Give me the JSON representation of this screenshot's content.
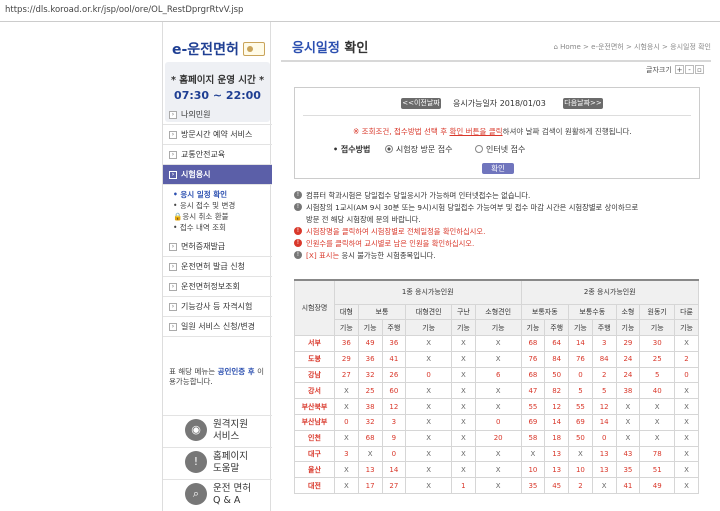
{
  "url": "https://dls.koroad.or.kr/jsp/ool/ore/OL_RestDprgrRtvV.jsp",
  "logo": "e-운전면허",
  "hours": {
    "title": "* 홈페이지 운영 시간 *",
    "time": "07:30 ~ 22:00"
  },
  "menu": {
    "top": [
      "나의민원",
      "방문시간 예약 서비스",
      "교통안전교육",
      "시험응시"
    ],
    "sub": [
      "응시 일정 확인",
      "응시 접수 및 변경",
      "응시 취소 환불",
      "접수 내역 조회"
    ],
    "bottom": [
      "면허증재발급",
      "운전면허 발급 신청",
      "운전면허정보조회",
      "기능강사 등 자격시험",
      "일원 서비스 신청/변경"
    ]
  },
  "note": {
    "pre": "표 해당 메뉴는 ",
    "link": "공인인증 후",
    "post": " 이용가능합니다."
  },
  "services": [
    {
      "icon": "wifi-icon",
      "glyph": "◉",
      "line1": "원격지원",
      "line2": "서비스"
    },
    {
      "icon": "alert-icon",
      "glyph": "!",
      "line1": "홈페이지",
      "line2": "도움말"
    },
    {
      "icon": "search-icon",
      "glyph": "⌕",
      "line1": "운전 면허",
      "line2": "Q & A"
    }
  ],
  "main": {
    "title_a": "응시일정",
    "title_b": " 확인",
    "breadcrumb": "⌂ Home > e-운전면허 > 시험응시 > 응시일정 확인",
    "fontsize_label": "글자크기",
    "prev_date": "<<이전날짜",
    "date_label": "응시가능일자  2018/01/03",
    "next_date": "다음날짜>>",
    "info_pre": "※ 조회조건, 접수방법 선택 후 ",
    "info_link": "확인 버튼을 클릭",
    "info_post": "하셔야 날짜 검색이 원활하게 진행됩니다.",
    "method_label": "• 접수방법",
    "method_opt1": "시험장 방문 접수",
    "method_opt2": "인터넷 접수",
    "confirm": "확인"
  },
  "notes": [
    {
      "red": false,
      "text": "컴퓨터 학과시험은 당일접수 당일응시가 가능하며 인터넷접수는 없습니다."
    },
    {
      "red": false,
      "text": "시험장의 1교시(AM 9시 30분 또는 9시)시험 당일접수 가능여부 및 접수 마감 시간은 시험장별로 상이하므로"
    },
    {
      "red": false,
      "text": "방문 전 해당 시험장에 문의 바랍니다.",
      "indent": true
    },
    {
      "red": true,
      "text": "시험장명을 클릭하여 시험장별로 전체일정을 확인하십시오."
    },
    {
      "red": true,
      "text": "인원수를 클릭하여 교시별로 남은 인원을 확인하십시오."
    },
    {
      "red": false,
      "mark": "[X] 표시는",
      "text": " 응시 불가능한 시험종목입니다."
    }
  ],
  "table": {
    "h_site": "시험장명",
    "h_class1": "1종 응시가능인원",
    "h_class2": "2종 응시가능인원",
    "h2": [
      {
        "label": "대형",
        "span": 1
      },
      {
        "label": "보통",
        "span": 2
      },
      {
        "label": "대형견인",
        "span": 1
      },
      {
        "label": "구난",
        "span": 1
      },
      {
        "label": "소형견인",
        "span": 1
      },
      {
        "label": "보통자동",
        "span": 2
      },
      {
        "label": "보통수동",
        "span": 2
      },
      {
        "label": "소형",
        "span": 1
      },
      {
        "label": "원동기",
        "span": 1
      },
      {
        "label": "다륜",
        "span": 1
      }
    ],
    "h3": [
      "기능",
      "기능",
      "주행",
      "기능",
      "기능",
      "기능",
      "기능",
      "주행",
      "기능",
      "주행",
      "기능",
      "기능",
      "기능"
    ],
    "rows": [
      {
        "site": "서부",
        "cells": [
          "36",
          "49",
          "36",
          "X",
          "X",
          "X",
          "68",
          "64",
          "14",
          "3",
          "29",
          "30",
          "X"
        ]
      },
      {
        "site": "도봉",
        "cells": [
          "29",
          "36",
          "41",
          "X",
          "X",
          "X",
          "76",
          "84",
          "76",
          "84",
          "24",
          "25",
          "2"
        ]
      },
      {
        "site": "강남",
        "cells": [
          "27",
          "32",
          "26",
          "0",
          "X",
          "6",
          "68",
          "50",
          "0",
          "2",
          "24",
          "5",
          "0"
        ]
      },
      {
        "site": "강서",
        "cells": [
          "X",
          "25",
          "60",
          "X",
          "X",
          "X",
          "47",
          "82",
          "5",
          "5",
          "38",
          "40",
          "X"
        ]
      },
      {
        "site": "부산북부",
        "cells": [
          "X",
          "38",
          "12",
          "X",
          "X",
          "X",
          "55",
          "12",
          "55",
          "12",
          "X",
          "X",
          "X"
        ]
      },
      {
        "site": "부산남부",
        "cells": [
          "0",
          "32",
          "3",
          "X",
          "X",
          "0",
          "69",
          "14",
          "69",
          "14",
          "X",
          "X",
          "X"
        ]
      },
      {
        "site": "인천",
        "cells": [
          "X",
          "68",
          "9",
          "X",
          "X",
          "20",
          "58",
          "18",
          "50",
          "0",
          "X",
          "X",
          "X"
        ]
      },
      {
        "site": "대구",
        "cells": [
          "3",
          "X",
          "0",
          "X",
          "X",
          "X",
          "X",
          "13",
          "X",
          "13",
          "43",
          "78",
          "X"
        ]
      },
      {
        "site": "울산",
        "cells": [
          "X",
          "13",
          "14",
          "X",
          "X",
          "X",
          "10",
          "13",
          "10",
          "13",
          "35",
          "51",
          "X"
        ]
      },
      {
        "site": "대전",
        "cells": [
          "X",
          "17",
          "27",
          "X",
          "1",
          "X",
          "35",
          "45",
          "2",
          "X",
          "41",
          "49",
          "X"
        ]
      }
    ]
  }
}
